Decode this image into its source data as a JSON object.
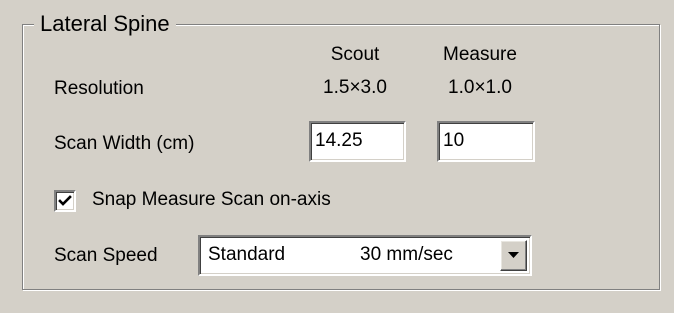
{
  "group": {
    "title": "Lateral Spine"
  },
  "columns": {
    "scout": "Scout",
    "measure": "Measure"
  },
  "resolution": {
    "label": "Resolution",
    "scout": "1.5×3.0",
    "measure": "1.0×1.0"
  },
  "scan_width": {
    "label": "Scan Width (cm)",
    "scout_value": "14.25",
    "measure_value": "10"
  },
  "snap": {
    "label": "Snap Measure Scan on-axis",
    "checked": true
  },
  "scan_speed": {
    "label": "Scan Speed",
    "selected_name": "Standard",
    "selected_rate": "30 mm/sec"
  }
}
